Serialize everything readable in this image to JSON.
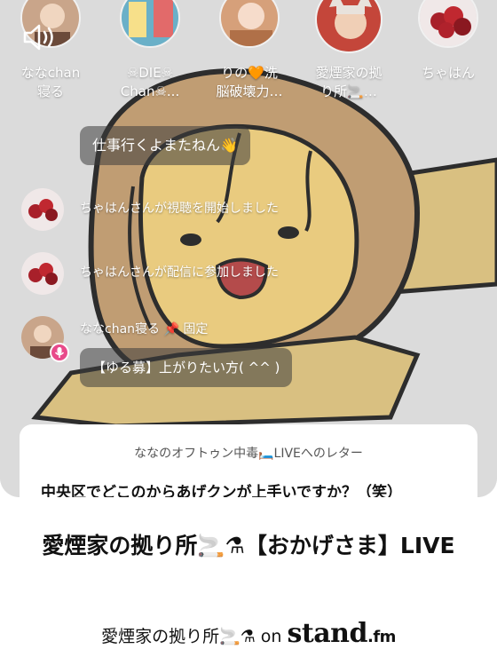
{
  "listeners": [
    {
      "label": "ななchan\n寝る",
      "avatar_color": "#c9a58a"
    },
    {
      "label": "☠DIE☠\nChan☠...",
      "avatar_color": "#6ab0c8"
    },
    {
      "label": "りの🧡洗\n脳破壊力…",
      "avatar_color": "#d6a07a"
    },
    {
      "label": "愛煙家の拠\nり所🚬…",
      "avatar_color": "#c4463a"
    },
    {
      "label": "ちゃはん",
      "avatar_color": "#a8202a"
    }
  ],
  "chat": {
    "bubble_top": "仕事行くよまたねん👋",
    "messages": [
      {
        "text": "ちゃはんさんが視聴を開始しました"
      },
      {
        "text": "ちゃはんさんが配信に参加しました"
      },
      {
        "text": "ななchan寝る 📌 固定"
      }
    ],
    "pinned_bubble": "【ゆる募】上がりたい方( ^^ )"
  },
  "letter": {
    "title": "ななのオフトゥン中毒🛏️LIVEへのレター",
    "body": "中央区でどこのからあげクンが上手いですか？（笑）"
  },
  "title": "愛煙家の拠り所🚬⚗【おかげさま】LIVE",
  "footer": {
    "prefix": "愛煙家の拠り所🚬⚗ on ",
    "brand": "stand",
    "brand_suffix": ".fm"
  },
  "colors": {
    "mic_badge": "#e84a8a",
    "illustration_hair": "#b98e5e",
    "illustration_skin": "#e8c87a"
  }
}
